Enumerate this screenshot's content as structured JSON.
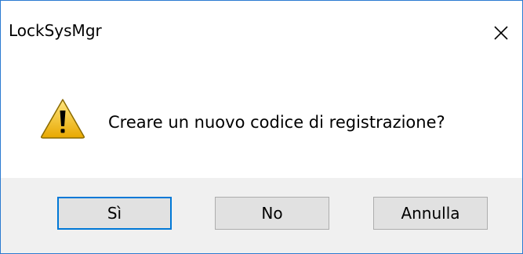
{
  "window": {
    "title": "LockSysMgr",
    "close_icon": "close-icon"
  },
  "content": {
    "icon": "warning-icon",
    "message": "Creare un nuovo codice di registrazione?"
  },
  "buttons": {
    "yes_label": "Sì",
    "no_label": "No",
    "cancel_label": "Annulla"
  },
  "colors": {
    "accent": "#0078d7",
    "warning_yellow": "#f6c21c"
  }
}
